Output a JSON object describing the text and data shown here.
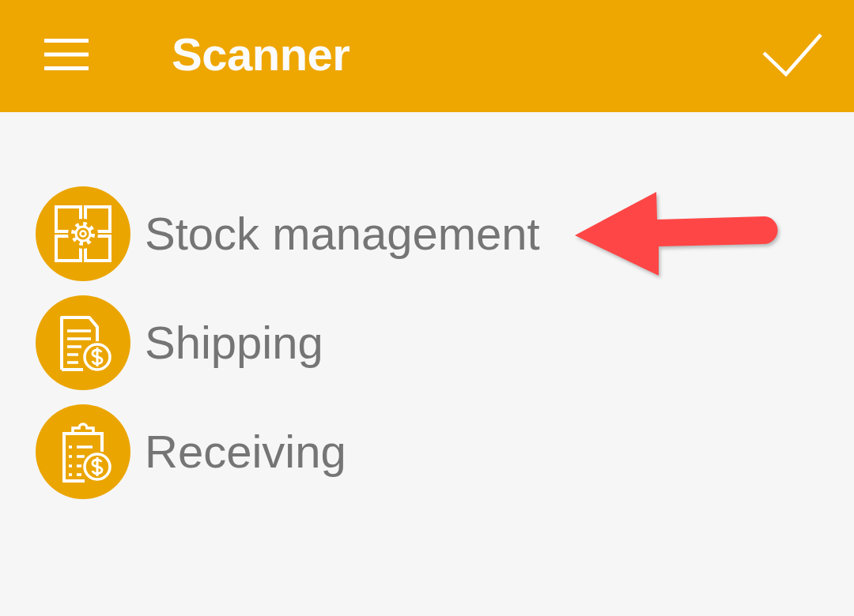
{
  "app_bar": {
    "title": "Scanner"
  },
  "menu": {
    "items": [
      {
        "label": "Stock management",
        "arrow_marked": true
      },
      {
        "label": "Shipping",
        "arrow_marked": false
      },
      {
        "label": "Receiving",
        "arrow_marked": false
      }
    ]
  }
}
